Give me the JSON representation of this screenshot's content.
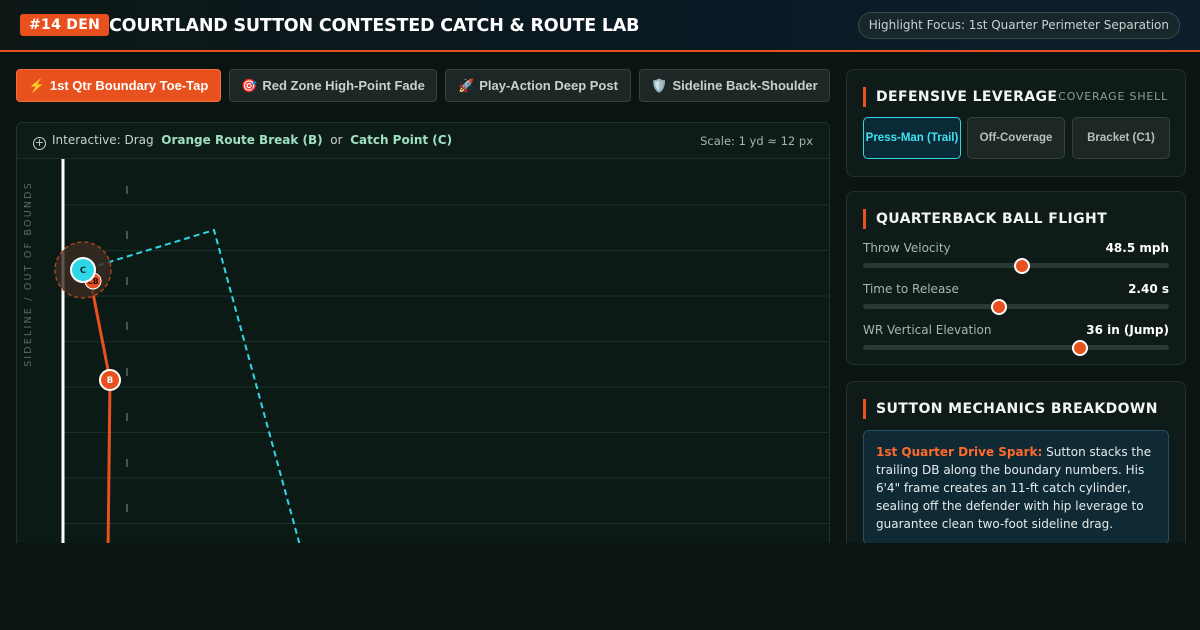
{
  "header": {
    "badge": "#14 DEN",
    "title": "COURTLAND SUTTON CONTESTED CATCH & ROUTE LAB",
    "focus": "Highlight Focus: 1st Quarter Perimeter Separation"
  },
  "scenarios": [
    {
      "icon": "⚡",
      "label": "1st Qtr Boundary Toe-Tap",
      "active": true
    },
    {
      "icon": "🎯",
      "label": "Red Zone High-Point Fade",
      "active": false
    },
    {
      "icon": "🚀",
      "label": "Play-Action Deep Post",
      "active": false
    },
    {
      "icon": "🛡️",
      "label": "Sideline Back-Shoulder",
      "active": false
    }
  ],
  "field": {
    "hint_prefix": "Interactive: Drag",
    "hint_route": "Orange Route Break (B)",
    "hint_or": "or",
    "hint_catch": "Catch Point (C)",
    "scale": "Scale: 1 yd ≈ 12 px",
    "sideline_label": "SIDELINE / OUT OF BOUNDS",
    "markers": {
      "route_break": "B",
      "catch_point": "C",
      "defender": "CB"
    },
    "colors": {
      "route": "#e8501d",
      "ball_path": "#2fd6e6",
      "sideline": "#ffffff"
    }
  },
  "leverage": {
    "title": "DEFENSIVE LEVERAGE",
    "subtitle": "COVERAGE SHELL",
    "options": [
      {
        "label": "Press-Man (Trail)",
        "active": true
      },
      {
        "label": "Off-Coverage",
        "active": false
      },
      {
        "label": "Bracket (C1)",
        "active": false
      }
    ]
  },
  "ball_flight": {
    "title": "QUARTERBACK BALL FLIGHT",
    "sliders": [
      {
        "label": "Throw Velocity",
        "value": "48.5 mph",
        "fraction": 0.52
      },
      {
        "label": "Time to Release",
        "value": "2.40 s",
        "fraction": 0.446
      },
      {
        "label": "WR Vertical Elevation",
        "value": "36 in (Jump)",
        "fraction": 0.71
      }
    ]
  },
  "mechanics": {
    "title": "SUTTON MECHANICS BREAKDOWN",
    "lead": "1st Quarter Drive Spark:",
    "body": " Sutton stacks the trailing DB along the boundary numbers. His 6'4\" frame creates an 11-ft catch cylinder, sealing off the defender with hip leverage to guarantee clean two-foot sideline drag."
  }
}
